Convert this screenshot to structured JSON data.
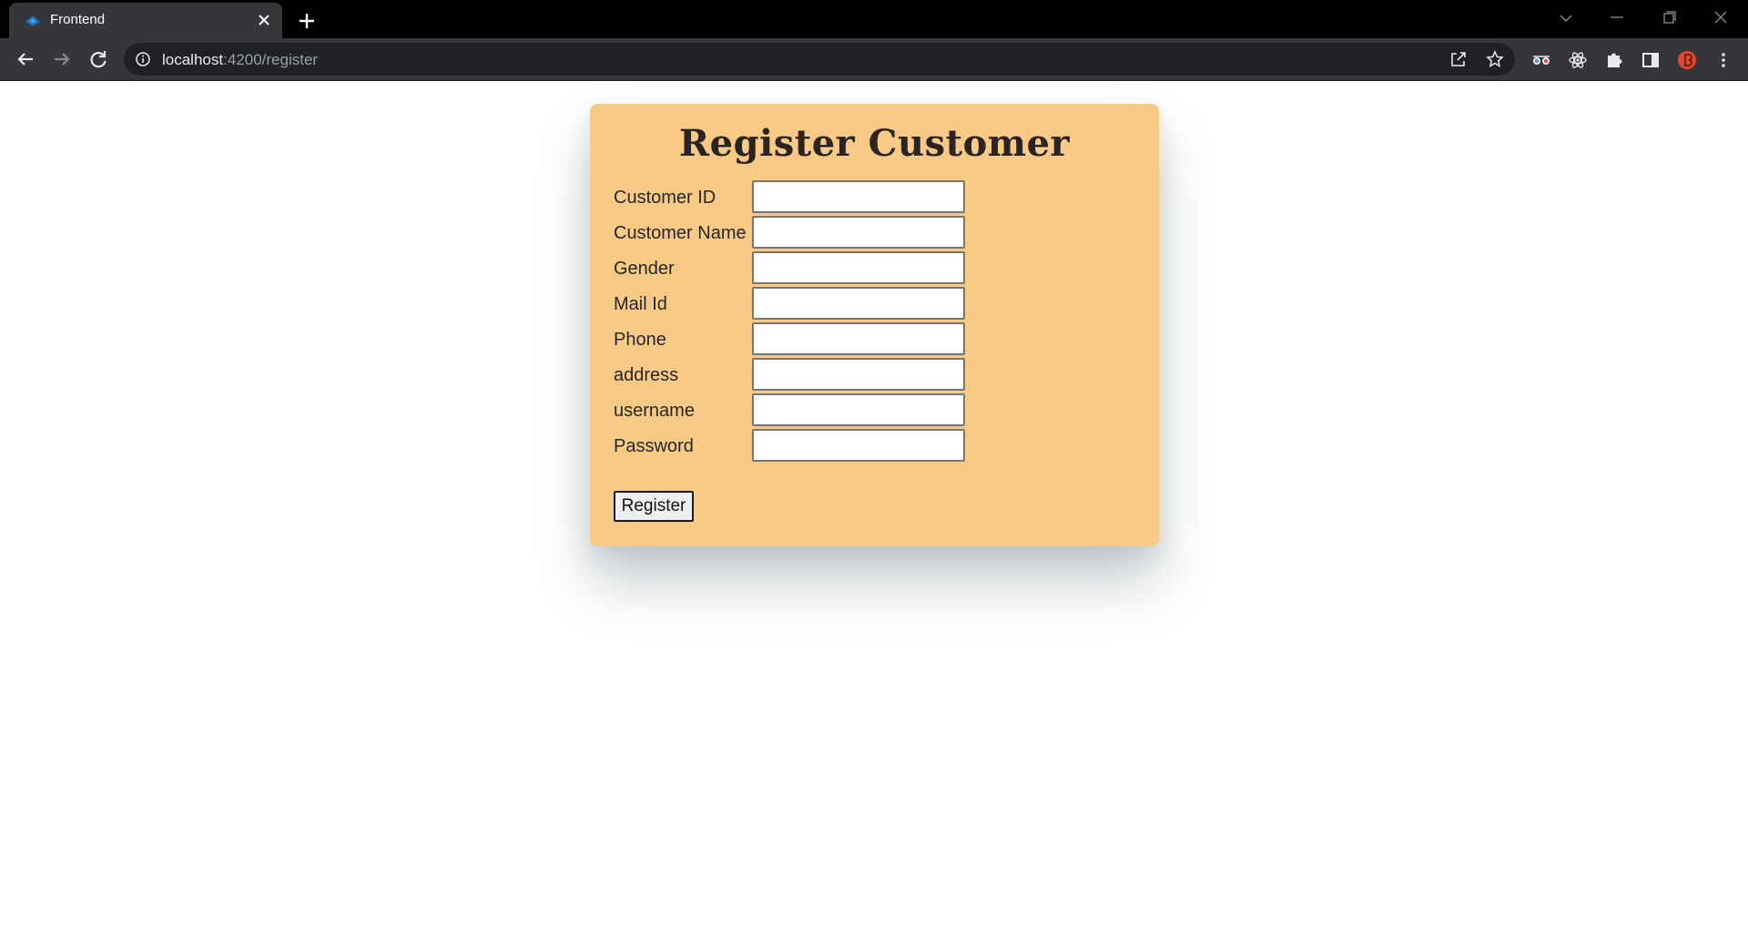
{
  "browser": {
    "tab_title": "Frontend",
    "url_host": "localhost",
    "url_path": ":4200/register",
    "favicon": "angular-icon",
    "profile_color": "#e8452c"
  },
  "form": {
    "title": "Register Customer",
    "background": "#f9ca85",
    "fields": [
      {
        "label": "Customer ID",
        "value": ""
      },
      {
        "label": "Customer Name",
        "value": ""
      },
      {
        "label": "Gender",
        "value": ""
      },
      {
        "label": "Mail Id",
        "value": ""
      },
      {
        "label": "Phone",
        "value": ""
      },
      {
        "label": "address",
        "value": ""
      },
      {
        "label": "username",
        "value": ""
      },
      {
        "label": "Password",
        "value": ""
      }
    ],
    "submit_label": "Register"
  }
}
